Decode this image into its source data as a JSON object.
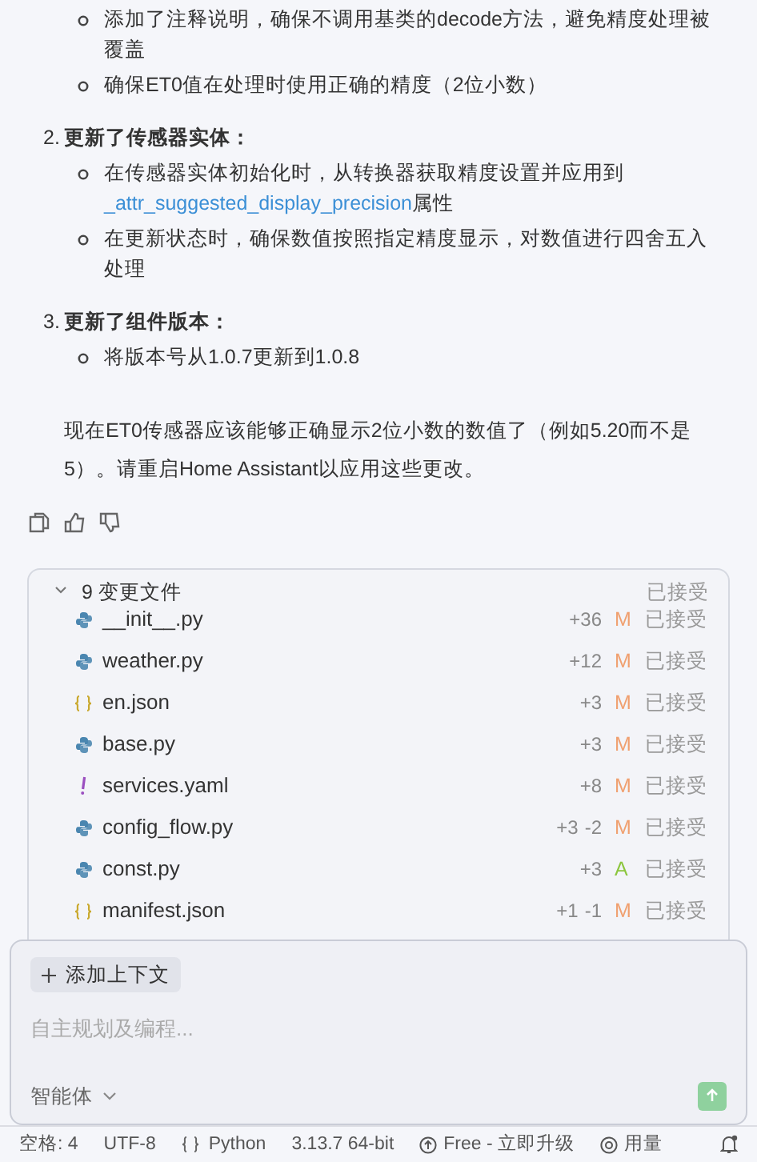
{
  "message": {
    "top_bullets": [
      "添加了注释说明，确保不调用基类的decode方法，避免精度处理被覆盖",
      "确保ET0值在处理时使用正确的精度（2位小数）"
    ],
    "sections": [
      {
        "number": "2.",
        "title": "更新了传感器实体：",
        "bullets": [
          {
            "before": "在传感器实体初始化时，从转换器获取精度设置并应用到",
            "link": "_attr_suggested_display_precision",
            "after": "属性"
          },
          {
            "before": "在更新状态时，确保数值按照指定精度显示，对数值进行四舍五入处理"
          }
        ]
      },
      {
        "number": "3.",
        "title": "更新了组件版本：",
        "bullets": [
          {
            "before": "将版本号从1.0.7更新到1.0.8"
          }
        ]
      }
    ],
    "summary": "现在ET0传感器应该能够正确显示2位小数的数值了（例如5.20而不是5）。请重启Home Assistant以应用这些更改。"
  },
  "changes": {
    "expanded": true,
    "title": "9 变更文件",
    "status": "已接受",
    "files": [
      {
        "kind": "python",
        "name": "__init__.py",
        "added": "+36",
        "change": "M",
        "status": "已接受"
      },
      {
        "kind": "python",
        "name": "weather.py",
        "added": "+12",
        "change": "M",
        "status": "已接受"
      },
      {
        "kind": "json",
        "name": "en.json",
        "added": "+3",
        "change": "M",
        "status": "已接受"
      },
      {
        "kind": "python",
        "name": "base.py",
        "added": "+3",
        "change": "M",
        "status": "已接受"
      },
      {
        "kind": "yaml",
        "name": "services.yaml",
        "added": "+8",
        "change": "M",
        "status": "已接受"
      },
      {
        "kind": "python",
        "name": "config_flow.py",
        "added": "+3",
        "removed": "-2",
        "change": "M",
        "status": "已接受"
      },
      {
        "kind": "python",
        "name": "const.py",
        "added": "+3",
        "change": "A",
        "status": "已接受"
      },
      {
        "kind": "json",
        "name": "manifest.json",
        "added": "+1",
        "removed": "-1",
        "change": "M",
        "status": "已接受"
      }
    ]
  },
  "composer": {
    "context_button": "添加上下文",
    "placeholder": "自主规划及编程...",
    "mode": "智能体"
  },
  "status_bar": [
    {
      "kind": "text",
      "label": "空格: 4"
    },
    {
      "kind": "text",
      "label": "UTF-8"
    },
    {
      "kind": "braces",
      "label": "Python"
    },
    {
      "kind": "text",
      "label": "3.13.7 64-bit"
    },
    {
      "kind": "upgrade",
      "label": "Free - 立即升级"
    },
    {
      "kind": "usage",
      "label": "用量"
    },
    {
      "kind": "bell"
    }
  ]
}
